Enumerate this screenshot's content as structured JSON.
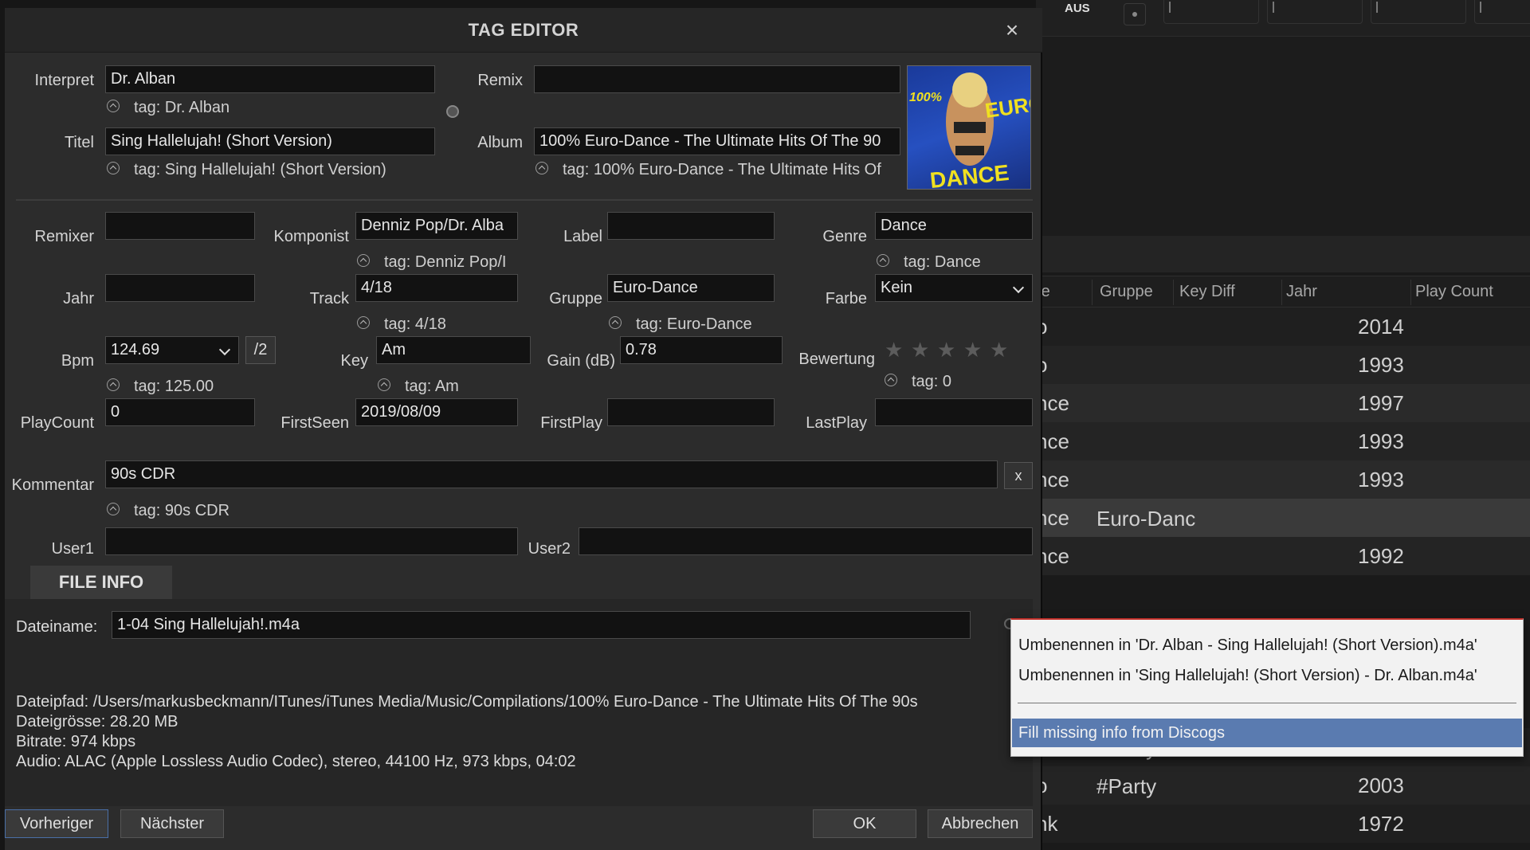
{
  "background": {
    "toolbar_label": "AUS",
    "headers": [
      "re",
      "Gruppe",
      "Key Diff",
      "Jahr",
      "Play Count"
    ],
    "rows": [
      {
        "c1": "o",
        "c2": "",
        "c3": "2014"
      },
      {
        "c1": "o",
        "c2": "",
        "c3": "1993"
      },
      {
        "c1": "nce",
        "c2": "",
        "c3": "1997"
      },
      {
        "c1": "nce",
        "c2": "",
        "c3": "1993"
      },
      {
        "c1": "nce",
        "c2": "",
        "c3": "1993"
      },
      {
        "c1": "nce",
        "c2": "Euro-Danc",
        "c3": ""
      },
      {
        "c1": "nce",
        "c2": "",
        "c3": "1992"
      },
      {
        "c1": "o",
        "c2": "#Party",
        "c3": "2003"
      },
      {
        "c1": "o",
        "c2": "#Party",
        "c3": "2003"
      },
      {
        "c1": "nk",
        "c2": "",
        "c3": "1972"
      }
    ]
  },
  "dialog": {
    "title": "TAG EDITOR",
    "close_label": "×",
    "interpret": {
      "label": "Interpret",
      "value": "Dr. Alban",
      "tag": "tag: Dr. Alban"
    },
    "titel": {
      "label": "Titel",
      "value": "Sing Hallelujah! (Short Version)",
      "tag": "tag: Sing Hallelujah! (Short Version)"
    },
    "remix": {
      "label": "Remix",
      "value": ""
    },
    "album": {
      "label": "Album",
      "value": "100% Euro-Dance - The Ultimate Hits Of The 90",
      "tag": "tag: 100% Euro-Dance - The Ultimate Hits Of"
    },
    "cover": {
      "text_top": "100%",
      "text_right": "EURO",
      "text_bottom": "DANCE"
    },
    "remixer": {
      "label": "Remixer",
      "value": ""
    },
    "komponist": {
      "label": "Komponist",
      "value": "Denniz Pop/Dr. Alba",
      "tag": "tag: Denniz Pop/I"
    },
    "label_field": {
      "label": "Label",
      "value": ""
    },
    "genre": {
      "label": "Genre",
      "value": "Dance",
      "tag": "tag: Dance"
    },
    "jahr": {
      "label": "Jahr",
      "value": ""
    },
    "track": {
      "label": "Track",
      "value": "4/18",
      "tag": "tag: 4/18"
    },
    "gruppe": {
      "label": "Gruppe",
      "value": "Euro-Dance",
      "tag": "tag: Euro-Dance"
    },
    "farbe": {
      "label": "Farbe",
      "value": "Kein"
    },
    "bpm": {
      "label": "Bpm",
      "value": "124.69",
      "tag": "tag: 125.00",
      "half_label": "/2"
    },
    "key": {
      "label": "Key",
      "value": "Am",
      "tag": "tag: Am"
    },
    "gain": {
      "label": "Gain (dB)",
      "value": "0.78"
    },
    "bewertung": {
      "label": "Bewertung",
      "stars": 0,
      "star_glyph": "★",
      "tag": "tag: 0"
    },
    "playcount": {
      "label": "PlayCount",
      "value": "0"
    },
    "firstseen": {
      "label": "FirstSeen",
      "value": "2019/08/09"
    },
    "firstplay": {
      "label": "FirstPlay",
      "value": ""
    },
    "lastplay": {
      "label": "LastPlay",
      "value": ""
    },
    "kommentar": {
      "label": "Kommentar",
      "value": "90s CDR",
      "tag": "tag: 90s CDR",
      "clear_label": "x"
    },
    "user1": {
      "label": "User1",
      "value": ""
    },
    "user2": {
      "label": "User2",
      "value": ""
    },
    "file_info": {
      "tab_label": "FILE INFO",
      "dateiname_label": "Dateiname:",
      "dateiname": "1-04 Sing Hallelujah!.m4a",
      "dateipfad": "Dateipfad: /Users/markusbeckmann/ITunes/iTunes Media/Music/Compilations/100% Euro-Dance - The Ultimate Hits Of The 90s",
      "groesse": "Dateigrösse: 28.20 MB",
      "bitrate": "Bitrate: 974 kbps",
      "audio": "Audio: ALAC (Apple Lossless Audio Codec), stereo, 44100 Hz, 973 kbps, 04:02"
    },
    "buttons": {
      "prev": "Vorheriger",
      "next": "Nächster",
      "ok": "OK",
      "cancel": "Abbrechen"
    }
  },
  "context_menu": {
    "items": [
      "Umbenennen in 'Dr. Alban - Sing Hallelujah! (Short Version).m4a'",
      "Umbenennen in 'Sing Hallelujah! (Short Version) - Dr. Alban.m4a'",
      "Fill missing info from Discogs"
    ]
  }
}
